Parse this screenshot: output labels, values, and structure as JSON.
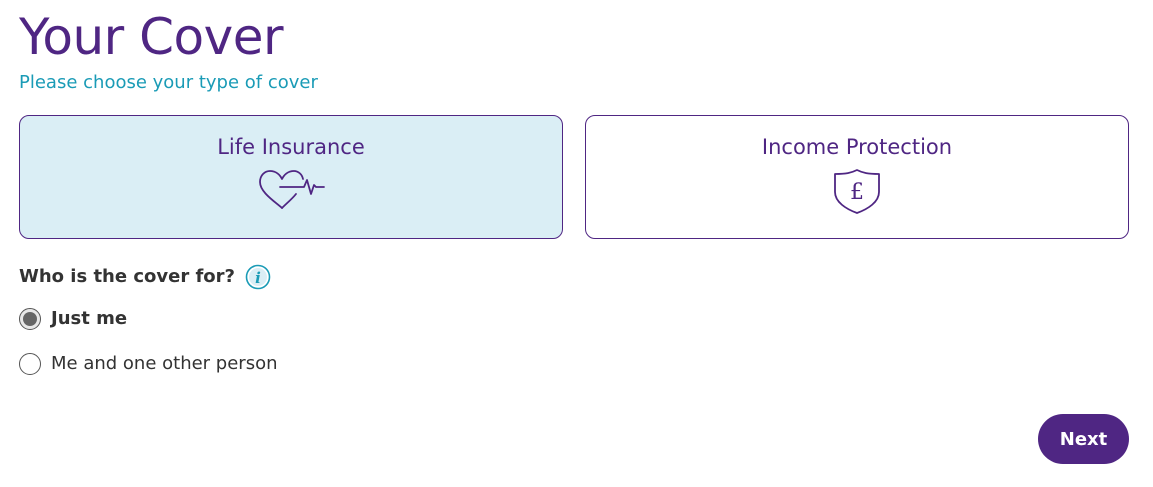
{
  "header": {
    "title": "Your Cover",
    "subtitle": "Please choose your type of cover"
  },
  "cover_types": [
    {
      "label": "Life Insurance",
      "icon": "heart-pulse-icon",
      "selected": true
    },
    {
      "label": "Income Protection",
      "icon": "pound-shield-icon",
      "selected": false
    }
  ],
  "question": {
    "text": "Who is the cover for?",
    "info_icon": "info-icon",
    "options": [
      {
        "label": "Just me",
        "checked": true
      },
      {
        "label": "Me and one other person",
        "checked": false
      }
    ]
  },
  "actions": {
    "next_label": "Next"
  },
  "colors": {
    "brand_purple": "#4f2683",
    "accent_teal": "#1a9bb6",
    "selected_bg": "#daeef5",
    "text": "#333333"
  }
}
